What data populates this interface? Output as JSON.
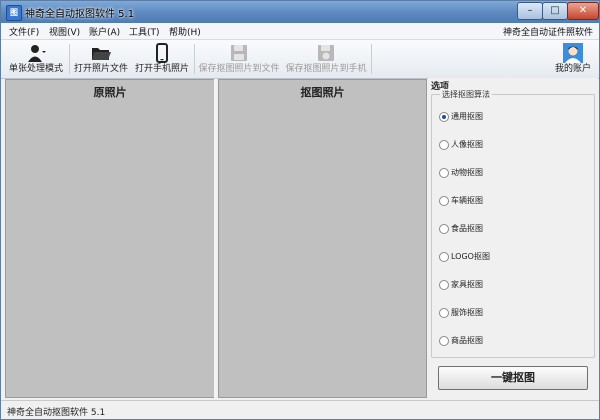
{
  "window": {
    "title": "神奇全自动抠图软件 5.1",
    "icon": "app-icon",
    "min": "–",
    "max": "□",
    "close": "✕"
  },
  "menu": {
    "items": [
      "文件(F)",
      "视图(V)",
      "账户(A)",
      "工具(T)",
      "帮助(H)"
    ],
    "right": "神奇全自动证件照软件"
  },
  "toolbar": {
    "single_mode": "单张处理模式",
    "open_file": "打开照片文件",
    "open_phone": "打开手机照片",
    "save_file": "保存抠图照片到文件",
    "save_phone": "保存抠图照片到手机",
    "account": "我的账户"
  },
  "panels": {
    "original": "原照片",
    "cutout": "抠图照片"
  },
  "options": {
    "header": "选项",
    "group_label": "选择抠图算法",
    "algorithms": [
      "通用抠图",
      "人像抠图",
      "动物抠图",
      "车辆抠图",
      "食品抠图",
      "LOGO抠图",
      "家具抠图",
      "服饰抠图",
      "商品抠图"
    ],
    "selected": "通用抠图",
    "button": "一键抠图"
  },
  "status": {
    "text": "神奇全自动抠图软件 5.1"
  }
}
